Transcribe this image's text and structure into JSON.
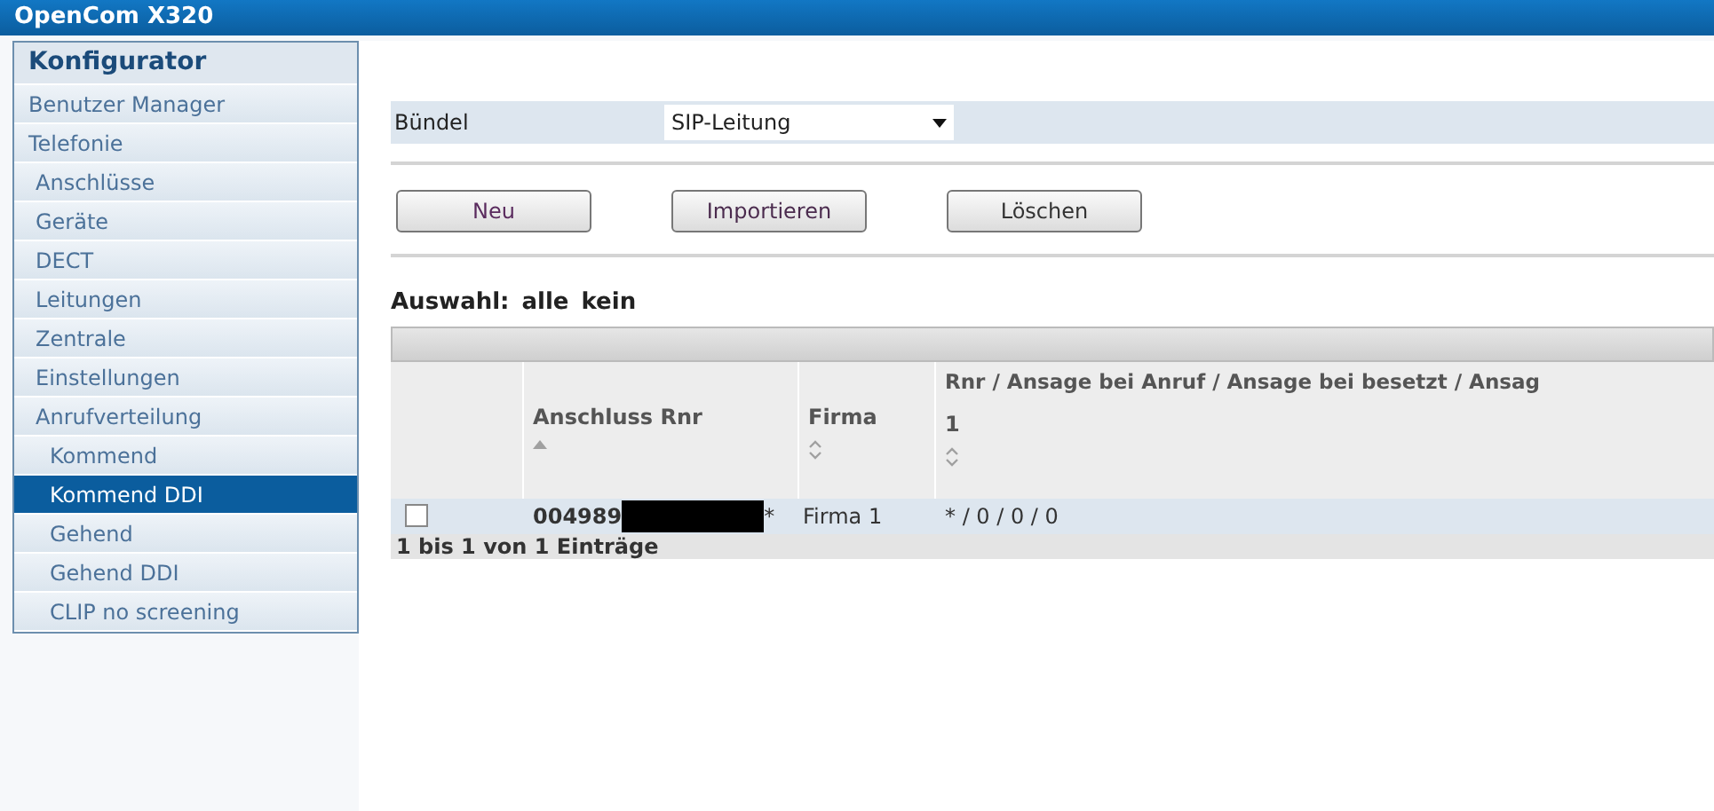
{
  "header": {
    "title": "OpenCom X320"
  },
  "sidebar": {
    "title": "Konfigurator",
    "items": [
      {
        "label": "Benutzer Manager",
        "selected": false
      },
      {
        "label": "Telefonie",
        "selected": false,
        "children": [
          {
            "label": "Anschlüsse",
            "selected": false
          },
          {
            "label": "Geräte",
            "selected": false
          },
          {
            "label": "DECT",
            "selected": false
          },
          {
            "label": "Leitungen",
            "selected": false
          },
          {
            "label": "Zentrale",
            "selected": false
          },
          {
            "label": "Einstellungen",
            "selected": false
          },
          {
            "label": "Anrufverteilung",
            "selected": false,
            "children": [
              {
                "label": "Kommend",
                "selected": false
              },
              {
                "label": "Kommend DDI",
                "selected": true
              },
              {
                "label": "Gehend",
                "selected": false
              },
              {
                "label": "Gehend DDI",
                "selected": false
              },
              {
                "label": "CLIP no screening",
                "selected": false
              }
            ]
          }
        ]
      }
    ]
  },
  "filter": {
    "label": "Bündel",
    "value": "SIP-Leitung"
  },
  "buttons": [
    "Neu",
    "Importieren",
    "Löschen"
  ],
  "selection": {
    "label": "Auswahl:",
    "all": "alle",
    "none": "kein"
  },
  "table": {
    "columns": [
      {
        "label": "Anschluss Rnr",
        "sorted": true
      },
      {
        "label": "Firma",
        "sorted": false
      },
      {
        "label": "Rnr / Ansage bei Anruf / Ansage bei besetzt / Ansag",
        "sublabel": "1",
        "sorted": false
      }
    ],
    "rows": [
      {
        "checked": false,
        "cells": [
          "004989",
          "Firma 1",
          "* / 0 / 0 / 0"
        ],
        "suffix": "*"
      }
    ],
    "footer": "1 bis 1 von 1 Einträge"
  }
}
